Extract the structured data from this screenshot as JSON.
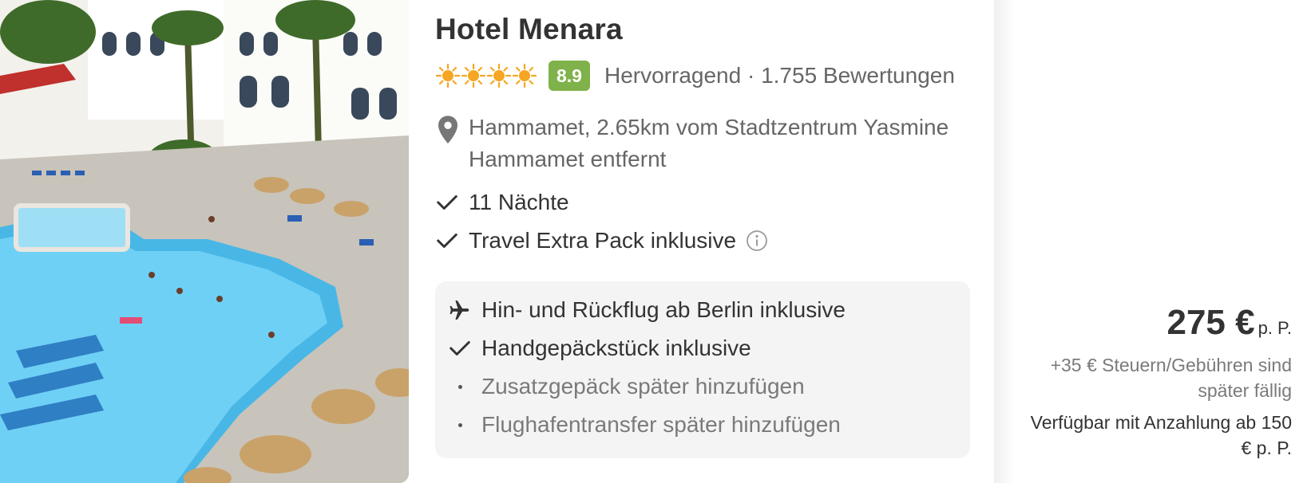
{
  "hotel": {
    "name": "Hotel Menara",
    "sun_count": 4,
    "score": "8.9",
    "rating_text": "Hervorragend · 1.755 Bewertungen",
    "location": "Hammamet, 2.65km vom Stadtzentrum Yasmine Hammamet entfernt"
  },
  "features": {
    "nights": "11 Nächte",
    "pack": "Travel Extra Pack inklusive"
  },
  "flight_box": {
    "flight": "Hin- und Rückflug ab Berlin inklusive",
    "hand_luggage": "Handgepäckstück inklusive",
    "extra_luggage": "Zusatzgepäck später hinzufügen",
    "transfer": "Flughafentransfer später hinzufügen"
  },
  "price": {
    "amount": "275 €",
    "unit": "p. P.",
    "fees": "+35 € Steuern/Gebühren sind später fällig",
    "deposit": "Verfügbar mit Anzahlung ab 150 € p. P."
  },
  "icons": {
    "sun": "sun-icon",
    "pin": "map-pin-icon",
    "check": "checkmark-icon",
    "info": "info-icon",
    "plane": "airplane-icon",
    "bullet": "bullet-dot-icon"
  },
  "colors": {
    "score_badge": "#7fb24a",
    "sun": "#f5a623",
    "flight_box_bg": "#f4f4f4",
    "muted_text": "#666666"
  }
}
